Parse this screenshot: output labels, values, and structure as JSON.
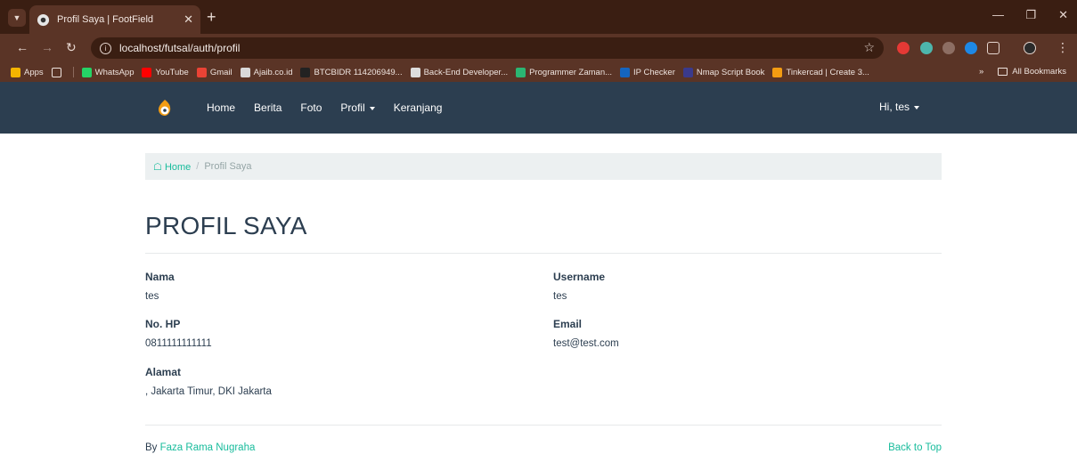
{
  "browser": {
    "tab_title": "Profil Saya | FootField",
    "url": "localhost/futsal/auth/profil",
    "bookmarks": [
      {
        "label": "Apps",
        "color": "#f4b400"
      },
      {
        "label": "WhatsApp",
        "color": "#25d366"
      },
      {
        "label": "YouTube",
        "color": "#ff0000"
      },
      {
        "label": "Gmail",
        "color": "#ea4335"
      },
      {
        "label": "Ajaib.co.id",
        "color": "#d9d9d9"
      },
      {
        "label": "BTCBIDR 114206949...",
        "color": "#222222"
      },
      {
        "label": "Back-End Developer...",
        "color": "#dddddd"
      },
      {
        "label": "Programmer Zaman...",
        "color": "#2bb673"
      },
      {
        "label": "IP Checker",
        "color": "#1565c0"
      },
      {
        "label": "Nmap Script Book",
        "color": "#3a3a8c"
      },
      {
        "label": "Tinkercad | Create 3...",
        "color": "#f39c12"
      }
    ],
    "all_bookmarks": "All Bookmarks"
  },
  "navbar": {
    "links": [
      "Home",
      "Berita",
      "Foto",
      "Profil",
      "Keranjang"
    ],
    "user": "Hi, tes"
  },
  "breadcrumb": {
    "home": "Home",
    "current": "Profil Saya"
  },
  "page_title": "PROFIL SAYA",
  "profile": {
    "nama_label": "Nama",
    "nama_value": "tes",
    "username_label": "Username",
    "username_value": "tes",
    "hp_label": "No. HP",
    "hp_value": "0811111111111",
    "email_label": "Email",
    "email_value": "test@test.com",
    "alamat_label": "Alamat",
    "alamat_value": ", Jakarta Timur, DKI Jakarta"
  },
  "footer": {
    "by": "By ",
    "author": "Faza Rama Nugraha",
    "back_to_top": "Back to Top"
  },
  "colors": {
    "navbar": "#2c3e50",
    "accent": "#18bc9c",
    "browser_frame": "#3a1e12"
  }
}
